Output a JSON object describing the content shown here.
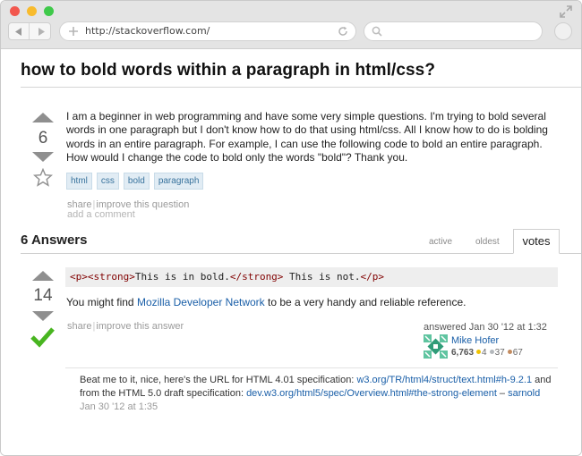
{
  "browser": {
    "url": "http://stackoverflow.com/"
  },
  "question": {
    "title": "how to bold words within a paragraph in html/css?",
    "votes": "6",
    "body": "I am a beginner in web programming and have some very simple questions. I'm trying to bold several words in one paragraph but I don't know how to do that using html/css. All I know how to do is bolding words in an entire paragraph. For example, I can use the following code to bold an entire paragraph. How would I change the code to bold only the words \"bold\"? Thank you.",
    "tags": [
      "html",
      "css",
      "bold",
      "paragraph"
    ],
    "menu": {
      "share": "share",
      "improve": "improve this question",
      "add_comment": "add a comment"
    }
  },
  "answers_header": "6 Answers",
  "sort_tabs": {
    "active": "active",
    "oldest": "oldest",
    "votes": "votes"
  },
  "answer": {
    "votes": "14",
    "code": {
      "p_open": "<p>",
      "strong_open": "<strong>",
      "bold_text": "This is in bold.",
      "strong_close": "</strong>",
      "plain_text": " This is not.",
      "p_close": "</p>"
    },
    "body_prefix": "You might find ",
    "body_link": "Mozilla Developer Network",
    "body_suffix": " to be a very handy and reliable reference.",
    "menu": {
      "share": "share",
      "improve": "improve this answer"
    },
    "answered": "answered Jan 30 '12 at 1:32",
    "user": {
      "name": "Mike Hofer",
      "reputation": "6,763",
      "gold": "4",
      "silver": "37",
      "bronze": "67"
    }
  },
  "comment": {
    "text1": "Beat me to it, nice, here's the URL for HTML 4.01 specification: ",
    "link1": "w3.org/TR/html4/struct/text.html#h-9.2.1",
    "text2": " and from the HTML 5.0 draft specification: ",
    "link2": "dev.w3.org/html5/spec/Overview.html#the-strong-element",
    "dash": " – ",
    "user": "sarnold",
    "when": "Jan 30 '12 at 1:35"
  },
  "colors": {
    "link": "#1a5fa8",
    "accept_green": "#48b520",
    "tag_bg": "#e1ecf4",
    "tag_text": "#39739d",
    "badge_gold": "#f0c300",
    "badge_silver": "#b4b8bc",
    "badge_bronze": "#c38b5f"
  },
  "icons": {
    "vote_up": "triangle-up-icon",
    "vote_down": "triangle-down-icon",
    "favorite": "star-icon",
    "accepted": "checkmark-icon",
    "reload": "reload-icon",
    "search": "search-icon",
    "new_tab": "plus-icon",
    "fullscreen": "expand-icon"
  }
}
